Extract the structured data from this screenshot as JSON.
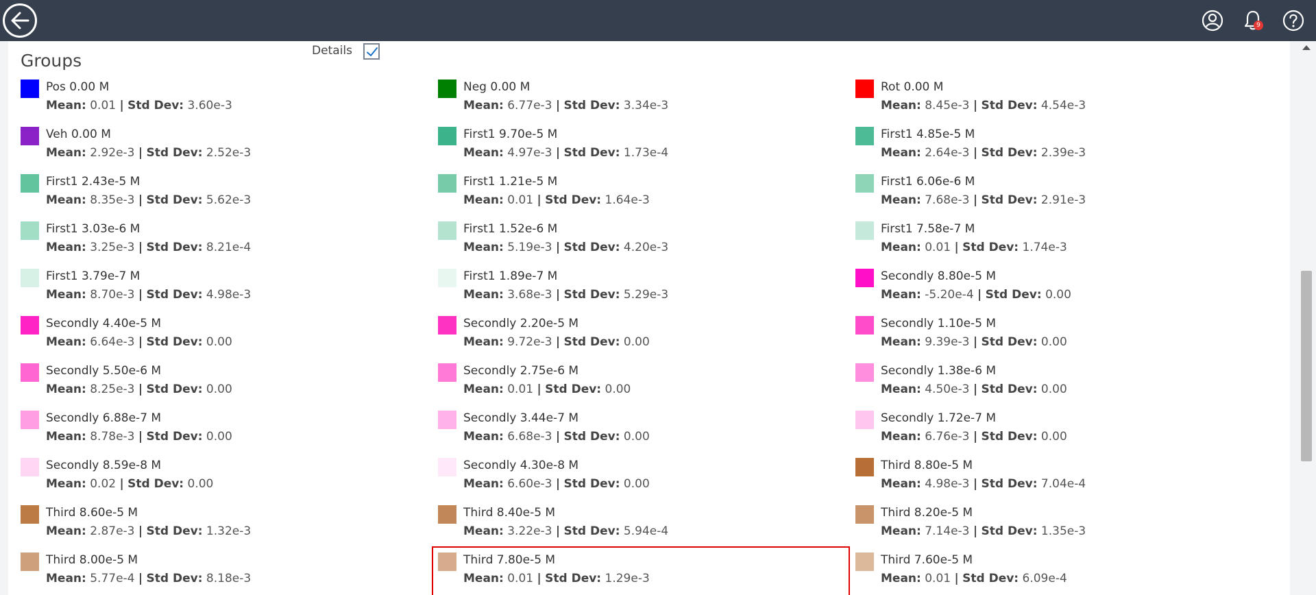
{
  "header": {
    "notification_count": "9"
  },
  "groups": {
    "title": "Groups",
    "details_label": "Details",
    "details_checked": true,
    "items": [
      {
        "name": "Pos 0.00 M",
        "mean": "0.01",
        "std": "3.60e-3",
        "color": "#0000ff"
      },
      {
        "name": "Neg 0.00 M",
        "mean": "6.77e-3",
        "std": "3.34e-3",
        "color": "#008000"
      },
      {
        "name": "Rot 0.00 M",
        "mean": "8.45e-3",
        "std": "4.54e-3",
        "color": "#ff0000"
      },
      {
        "name": "Veh 0.00 M",
        "mean": "2.92e-3",
        "std": "2.52e-3",
        "color": "#8b22c8"
      },
      {
        "name": "First1 9.70e-5 M",
        "mean": "4.97e-3",
        "std": "1.73e-4",
        "color": "#3cb38a"
      },
      {
        "name": "First1 4.85e-5 M",
        "mean": "2.64e-3",
        "std": "2.39e-3",
        "color": "#4dbb95"
      },
      {
        "name": "First1 2.43e-5 M",
        "mean": "8.35e-3",
        "std": "5.62e-3",
        "color": "#62c39f"
      },
      {
        "name": "First1 1.21e-5 M",
        "mean": "0.01",
        "std": "1.64e-3",
        "color": "#77cba9"
      },
      {
        "name": "First1 6.06e-6 M",
        "mean": "7.68e-3",
        "std": "2.91e-3",
        "color": "#8ed5b7"
      },
      {
        "name": "First1 3.03e-6 M",
        "mean": "3.25e-3",
        "std": "8.21e-4",
        "color": "#a2ddc5"
      },
      {
        "name": "First1 1.52e-6 M",
        "mean": "5.19e-3",
        "std": "4.20e-3",
        "color": "#b4e4d0"
      },
      {
        "name": "First1 7.58e-7 M",
        "mean": "0.01",
        "std": "1.74e-3",
        "color": "#c5eadb"
      },
      {
        "name": "First1 3.79e-7 M",
        "mean": "8.70e-3",
        "std": "4.98e-3",
        "color": "#d8f1e7"
      },
      {
        "name": "First1 1.89e-7 M",
        "mean": "3.68e-3",
        "std": "5.29e-3",
        "color": "#e9f7f1"
      },
      {
        "name": "Secondly 8.80e-5 M",
        "mean": "-5.20e-4",
        "std": "0.00",
        "color": "#ff10c8"
      },
      {
        "name": "Secondly 4.40e-5 M",
        "mean": "6.64e-3",
        "std": "0.00",
        "color": "#ff22c4"
      },
      {
        "name": "Secondly 2.20e-5 M",
        "mean": "9.72e-3",
        "std": "0.00",
        "color": "#ff33c2"
      },
      {
        "name": "Secondly 1.10e-5 M",
        "mean": "9.39e-3",
        "std": "0.00",
        "color": "#ff4cca"
      },
      {
        "name": "Secondly 5.50e-6 M",
        "mean": "8.25e-3",
        "std": "0.00",
        "color": "#ff66d2"
      },
      {
        "name": "Secondly 2.75e-6 M",
        "mean": "0.01",
        "std": "0.00",
        "color": "#ff7ad6"
      },
      {
        "name": "Secondly 1.38e-6 M",
        "mean": "4.50e-3",
        "std": "0.00",
        "color": "#ff8ede"
      },
      {
        "name": "Secondly 6.88e-7 M",
        "mean": "8.78e-3",
        "std": "0.00",
        "color": "#ff9ee3"
      },
      {
        "name": "Secondly 3.44e-7 M",
        "mean": "6.68e-3",
        "std": "0.00",
        "color": "#ffb2ea"
      },
      {
        "name": "Secondly 1.72e-7 M",
        "mean": "6.76e-3",
        "std": "0.00",
        "color": "#ffc6f0"
      },
      {
        "name": "Secondly 8.59e-8 M",
        "mean": "0.02",
        "std": "0.00",
        "color": "#ffd6f4"
      },
      {
        "name": "Secondly 4.30e-8 M",
        "mean": "6.60e-3",
        "std": "0.00",
        "color": "#ffe8f8"
      },
      {
        "name": "Third 8.80e-5 M",
        "mean": "4.98e-3",
        "std": "7.04e-4",
        "color": "#b86f35"
      },
      {
        "name": "Third 8.60e-5 M",
        "mean": "2.87e-3",
        "std": "1.32e-3",
        "color": "#bc7a45"
      },
      {
        "name": "Third 8.40e-5 M",
        "mean": "3.22e-3",
        "std": "5.94e-4",
        "color": "#c28758"
      },
      {
        "name": "Third 8.20e-5 M",
        "mean": "7.14e-3",
        "std": "1.35e-3",
        "color": "#c9946a"
      },
      {
        "name": "Third 8.00e-5 M",
        "mean": "5.77e-4",
        "std": "8.18e-3",
        "color": "#cfa07c"
      },
      {
        "name": "Third 7.80e-5 M",
        "mean": "0.01",
        "std": "1.29e-3",
        "color": "#d6ac8c",
        "highlighted": true
      },
      {
        "name": "Third 7.60e-5 M",
        "mean": "0.01",
        "std": "6.09e-4",
        "color": "#ddb99c"
      }
    ],
    "mean_label": "Mean:",
    "std_label": "Std Dev:",
    "separator": "|"
  }
}
